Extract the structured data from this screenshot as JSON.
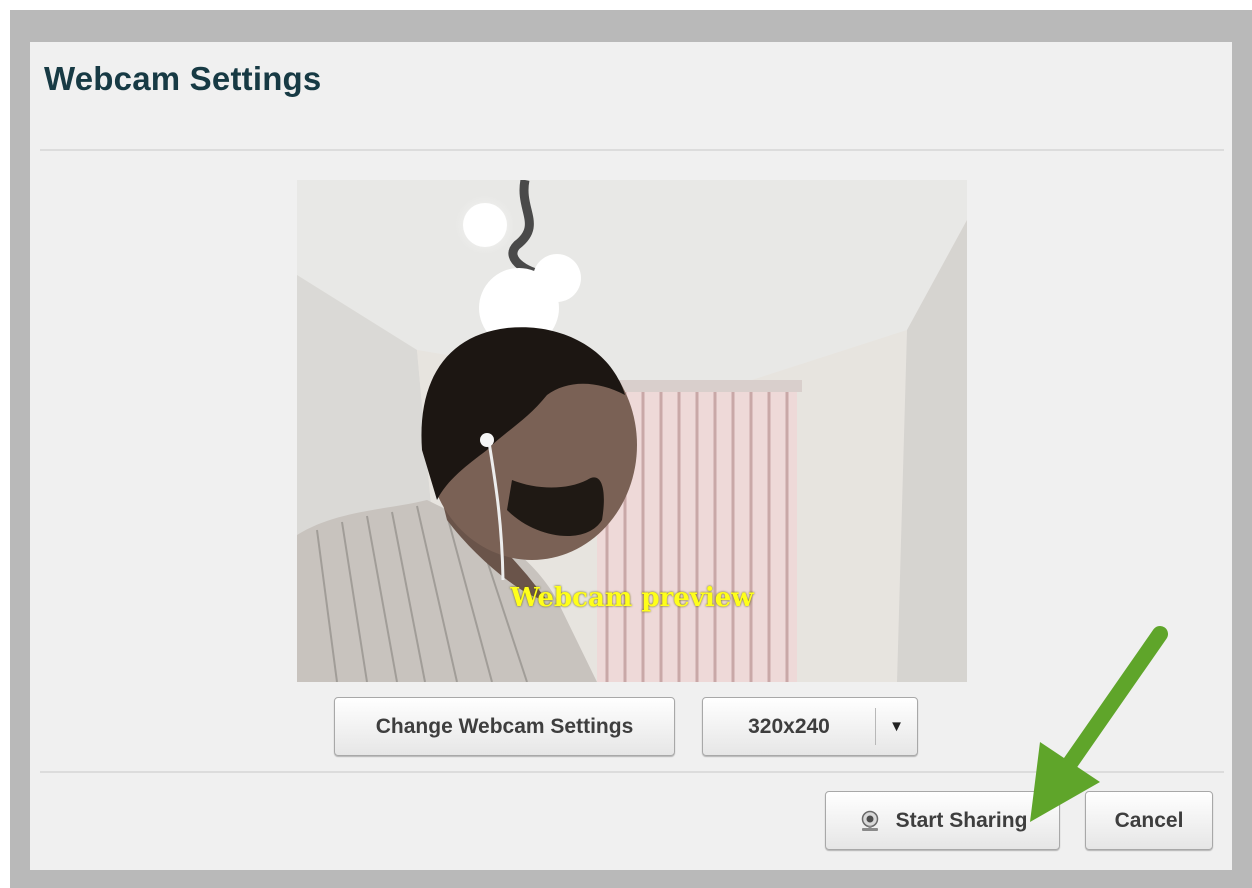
{
  "dialog": {
    "title": "Webcam Settings"
  },
  "preview": {
    "label": "Webcam preview"
  },
  "controls": {
    "change_settings_label": "Change Webcam Settings",
    "resolution_value": "320x240",
    "dropdown_icon": "triangle-down-icon"
  },
  "footer": {
    "start_sharing_label": "Start Sharing",
    "start_sharing_icon": "webcam-icon",
    "cancel_label": "Cancel"
  },
  "colors": {
    "title": "#173a44",
    "annotation_arrow": "#5fa52a",
    "preview_label": "#ffff1a"
  }
}
